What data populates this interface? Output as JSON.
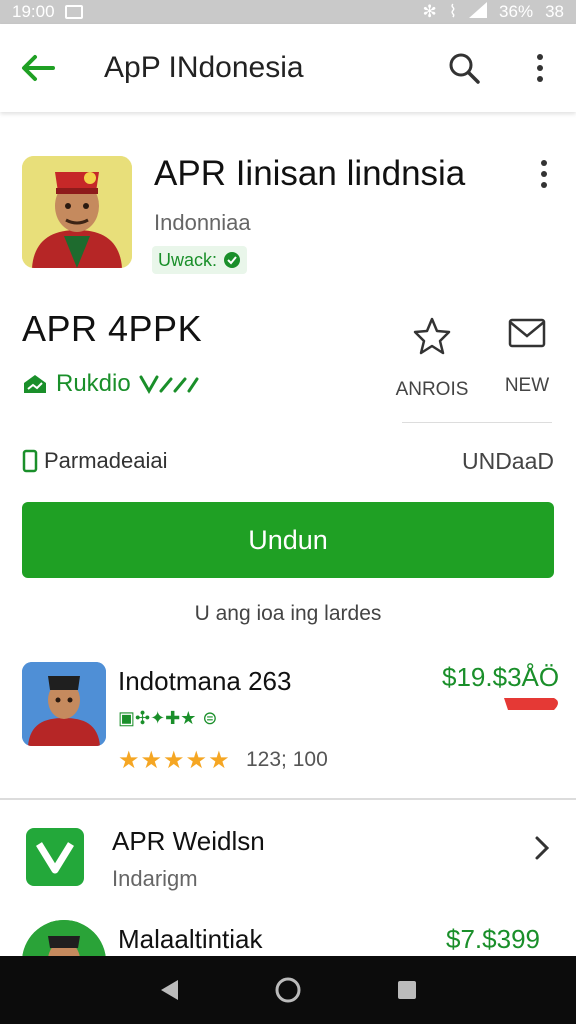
{
  "status_bar": {
    "time": "19:00",
    "battery": "36%",
    "extra": "38"
  },
  "app_bar": {
    "title": "ApP INdonesia"
  },
  "app": {
    "name": "APR Iinisan lindnsia",
    "developer": "Indonniaa",
    "verified": "Uwack:"
  },
  "detail": {
    "title": "APR 4PPK",
    "rating": "Rukdio",
    "wishlist_label": "ANROIS",
    "share_label": "NEW",
    "info_left": "Parmadeaiai",
    "info_right": "UNDaaD"
  },
  "install": {
    "label": "Undun"
  },
  "caption": "U ang ioa ing lardes",
  "list": [
    {
      "title": "Indotmana 263",
      "price": "$19.$3ÅÖ",
      "stars": "★★★★★",
      "count": "123; 100"
    },
    {
      "title": "APR Weidlsn",
      "subtitle": "Indarigm"
    },
    {
      "title": "Malaaltintiak",
      "price": "$7.$399"
    }
  ],
  "colors": {
    "accent": "#1fa024",
    "accent_text": "#1a8f2a",
    "star": "#f5a623"
  }
}
